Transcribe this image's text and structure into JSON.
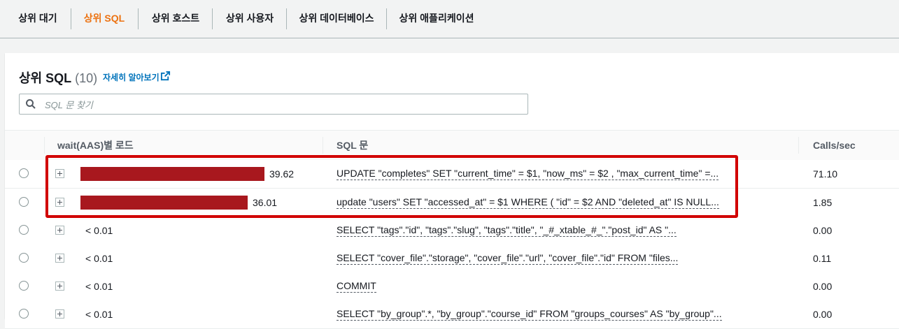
{
  "tabs": [
    {
      "label": "상위 대기"
    },
    {
      "label": "상위 SQL",
      "active": true
    },
    {
      "label": "상위 호스트"
    },
    {
      "label": "상위 사용자"
    },
    {
      "label": "상위 데이터베이스"
    },
    {
      "label": "상위 애플리케이션"
    }
  ],
  "panel": {
    "title": "상위 SQL",
    "count": "(10)",
    "info_link": "자세히 알아보기",
    "search_placeholder": "SQL 문 찾기"
  },
  "table": {
    "columns": [
      "wait(AAS)별 로드",
      "SQL 문",
      "Calls/sec"
    ],
    "rows": [
      {
        "load": "39.62",
        "load_value": 39.62,
        "sql": "UPDATE \"completes\" SET \"current_time\" = $1, \"now_ms\" = $2 , \"max_current_time\" =...",
        "calls": "71.10"
      },
      {
        "load": "36.01",
        "load_value": 36.01,
        "sql": "update \"users\" SET \"accessed_at\" = $1 WHERE ( \"id\" = $2 AND \"deleted_at\" IS NULL...",
        "calls": "1.85"
      },
      {
        "load": "< 0.01",
        "load_value": 0,
        "sql": "SELECT \"tags\".\"id\", \"tags\".\"slug\", \"tags\".\"title\", \"_#_xtable_#_\".\"post_id\" AS \"...",
        "calls": "0.00"
      },
      {
        "load": "< 0.01",
        "load_value": 0,
        "sql": "SELECT \"cover_file\".\"storage\", \"cover_file\".\"url\", \"cover_file\".\"id\" FROM \"files...",
        "calls": "0.11"
      },
      {
        "load": "< 0.01",
        "load_value": 0,
        "sql": "COMMIT",
        "calls": "0.00"
      },
      {
        "load": "< 0.01",
        "load_value": 0,
        "sql": "SELECT \"by_group\".*, \"by_group\".\"course_id\" FROM \"groups_courses\" AS \"by_group\"...",
        "calls": "0.00"
      }
    ]
  },
  "colors": {
    "accent": "#ec7211",
    "bar": "#a8181e",
    "link": "#0073bb",
    "highlight": "#d10000"
  }
}
